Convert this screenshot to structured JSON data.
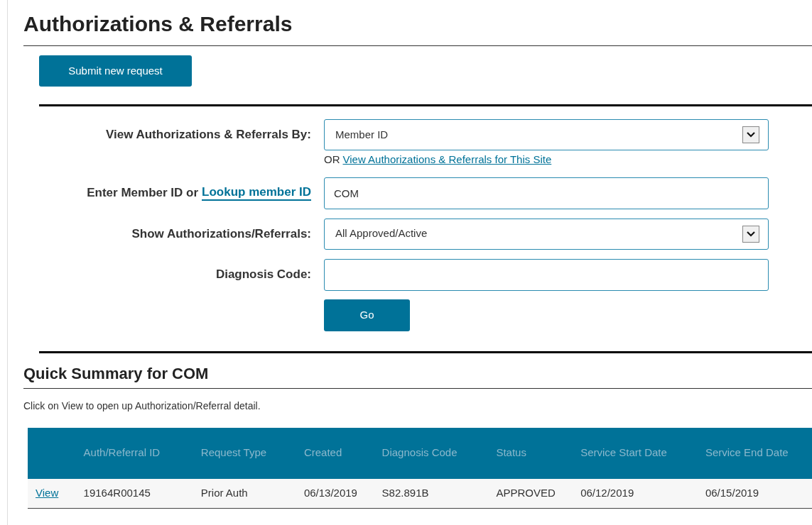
{
  "title": "Authorizations & Referrals",
  "submit_button": "Submit new request",
  "form": {
    "view_by": {
      "label": "View Authorizations & Referrals By:",
      "value": "Member ID",
      "or_text": "OR",
      "site_link": "View Authorizations & Referrals for This Site"
    },
    "member_id": {
      "label": "Enter Member ID or",
      "lookup_link": "Lookup member ID",
      "value": "COM"
    },
    "show": {
      "label": "Show Authorizations/Referrals:",
      "value": "All Approved/Active"
    },
    "diagnosis": {
      "label": "Diagnosis Code:"
    },
    "go_button": "Go"
  },
  "summary": {
    "title": "Quick Summary for COM",
    "hint": "Click on View to open up Authorization/Referral detail.",
    "table": {
      "columns": [
        "Auth/Referral ID",
        "Request Type",
        "Created",
        "Diagnosis Code",
        "Status",
        "Service Start Date",
        "Service End Date"
      ],
      "rows": [
        {
          "link": "View",
          "cells": [
            "19164R00145",
            "Prior Auth",
            "06/13/2019",
            "S82.891B",
            "APPROVED",
            "06/12/2019",
            "06/15/2019"
          ]
        }
      ]
    }
  }
}
